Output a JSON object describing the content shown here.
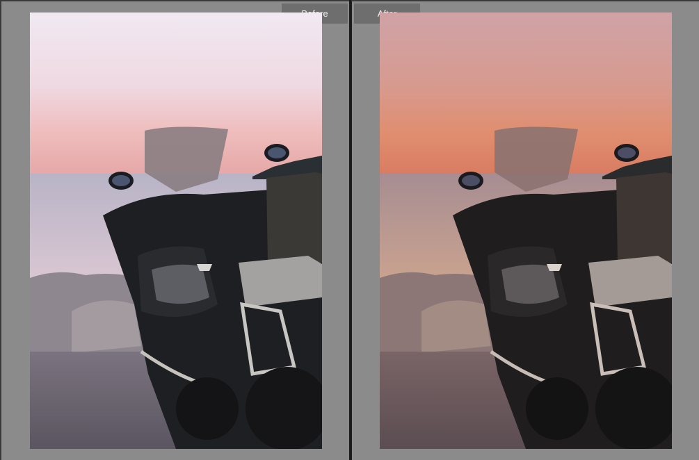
{
  "compare": {
    "before_label": "Before",
    "after_label": "After"
  },
  "colors": {
    "pane_background": "#8b8b8b",
    "tab_background": "#6e6e6e",
    "divider": "#1a1a1a"
  }
}
